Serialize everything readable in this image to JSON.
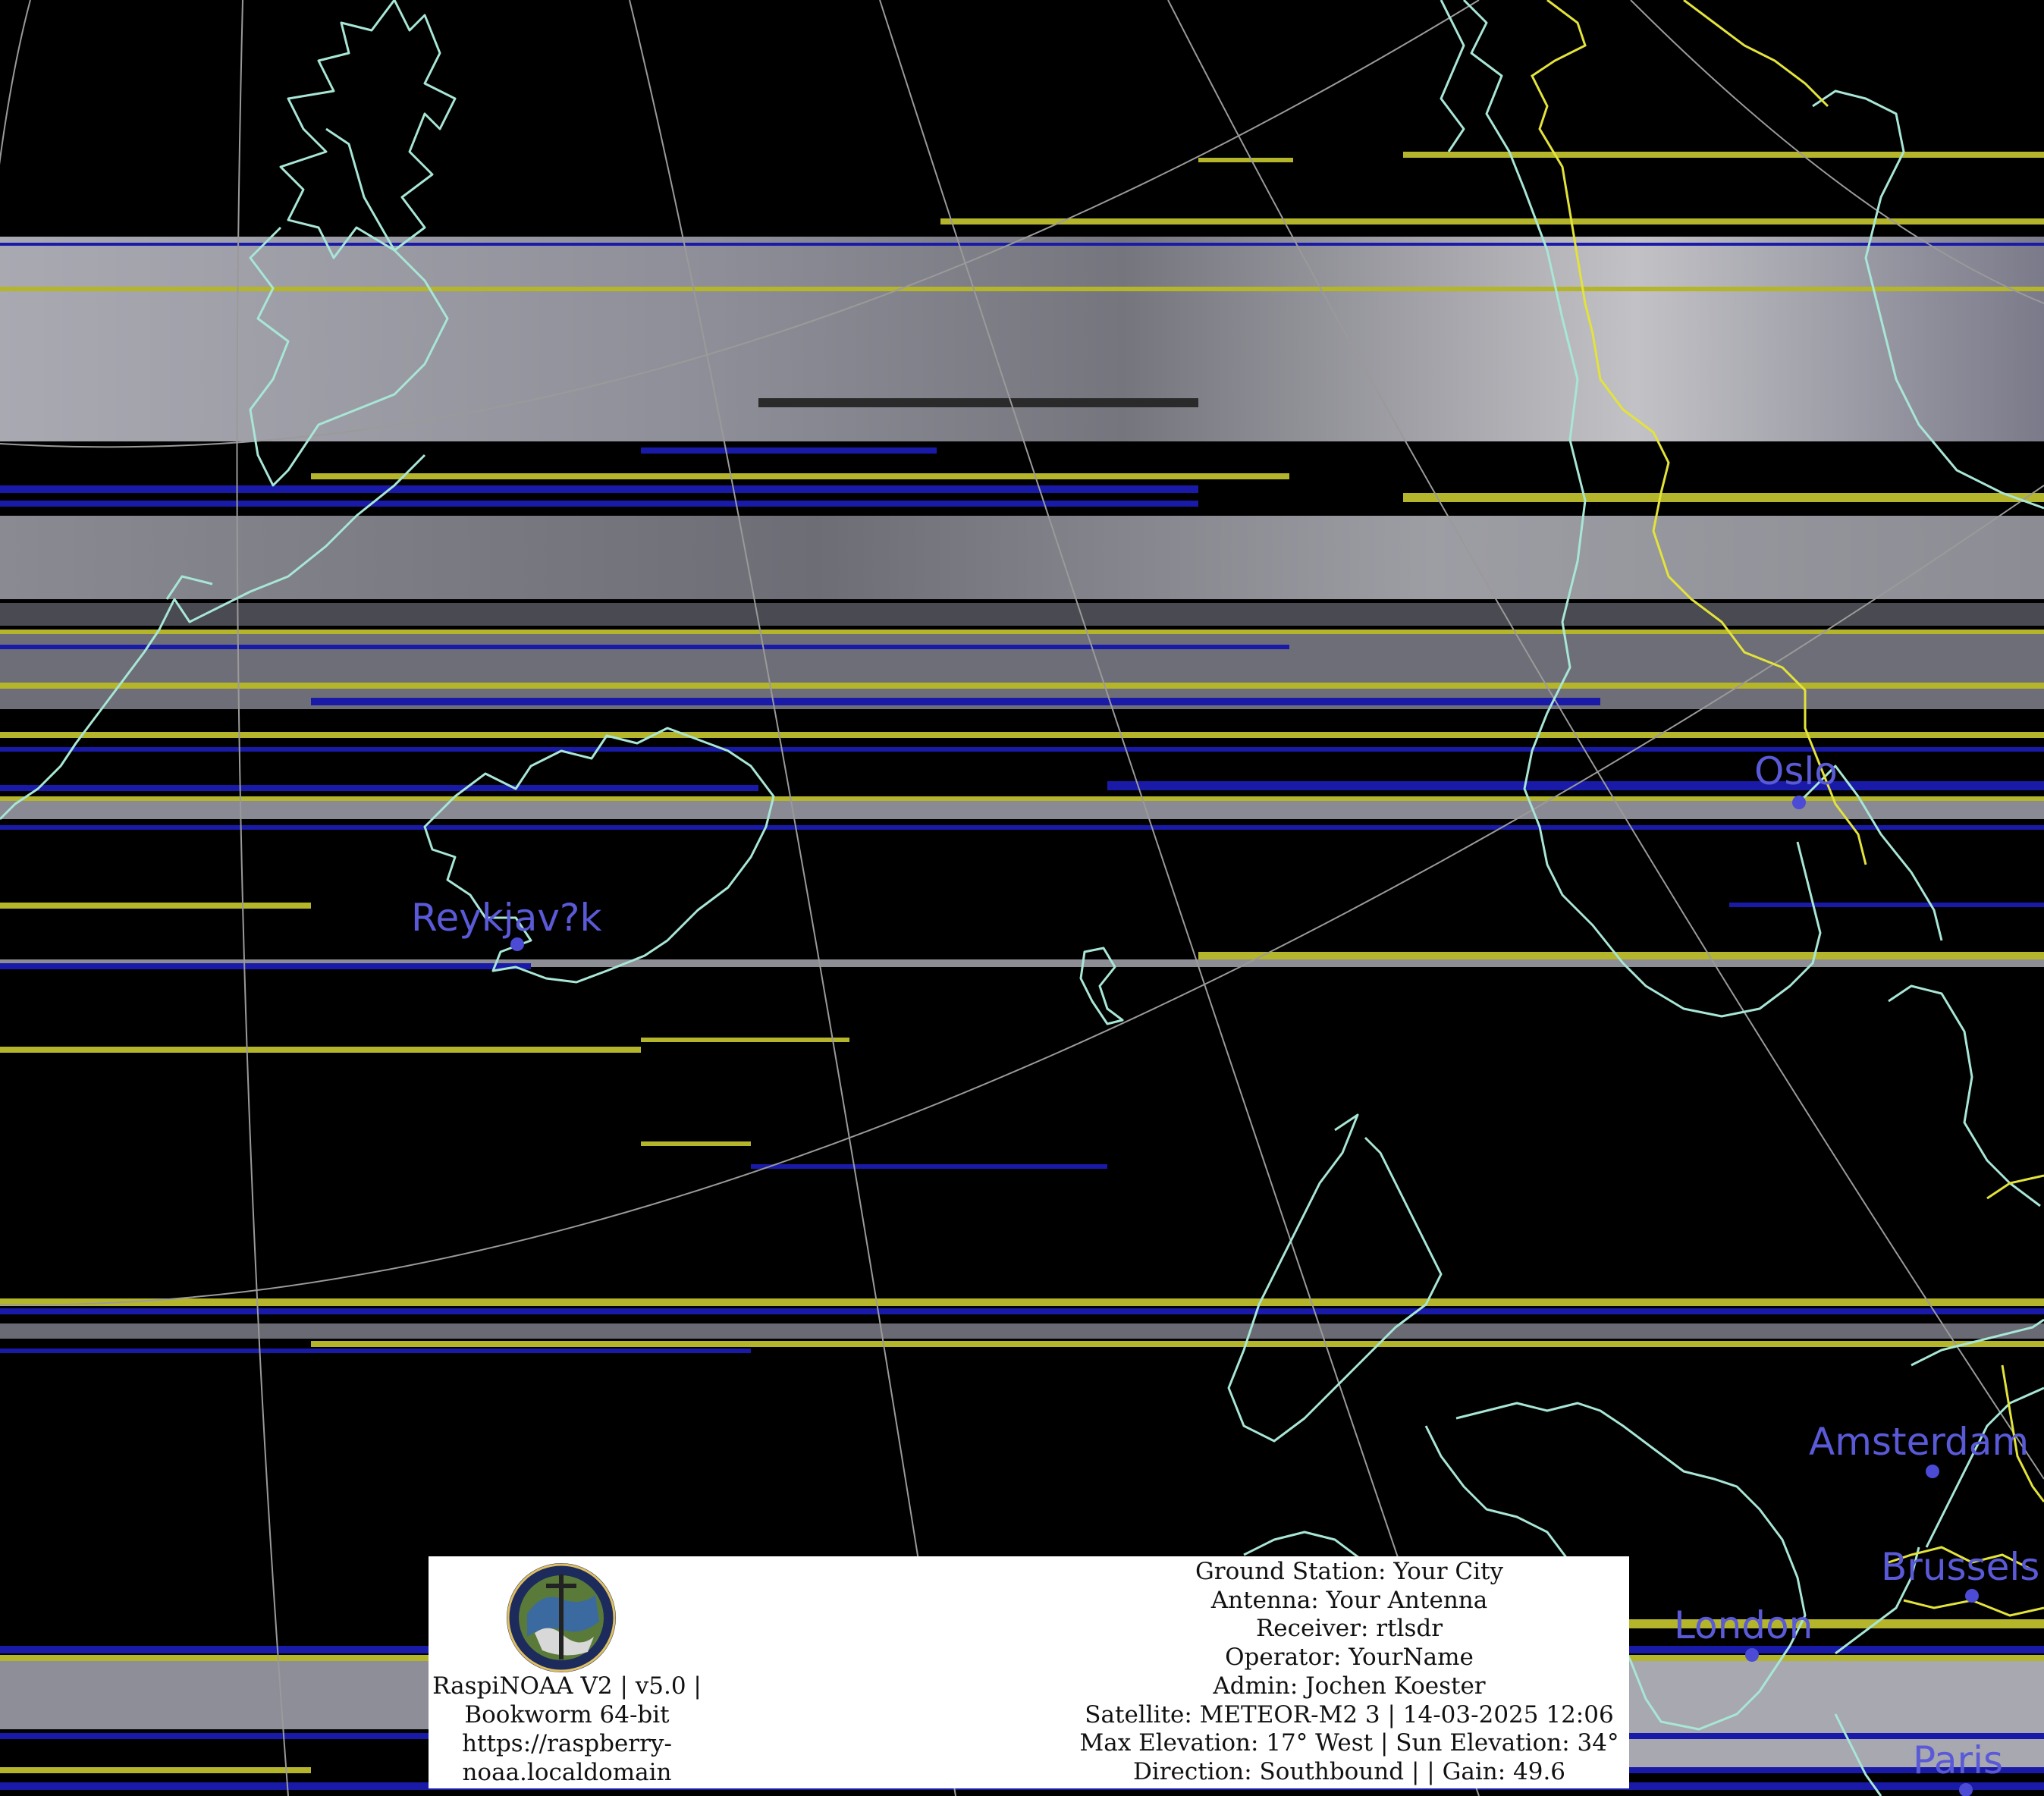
{
  "map": {
    "cities": [
      {
        "name": "Reykjav?k"
      },
      {
        "name": "Oslo"
      },
      {
        "name": "Amsterdam"
      },
      {
        "name": "Brussels"
      },
      {
        "name": "London"
      },
      {
        "name": "Paris"
      }
    ],
    "colors": {
      "background": "#000000",
      "coastline": "#a8e6d6",
      "border": "#e3e33b",
      "graticule": "#9a9a9a",
      "city": "#5a5ad8",
      "cloud": "#b4b4bc",
      "noise_yellow": "#b5b52c",
      "noise_blue": "#1a1aa8"
    }
  },
  "info_panel": {
    "logo_icon": "raspinoaa-logo-icon",
    "software_lines": [
      "RaspiNOAA V2 | v5.0 |",
      "Bookworm 64-bit",
      "https://raspberry-",
      "noaa.localdomain"
    ],
    "pass_lines": [
      "Ground Station: Your City",
      "Antenna: Your Antenna",
      "Receiver: rtlsdr",
      "Operator: YourName",
      "Admin: Jochen Koester",
      "Satellite: METEOR-M2 3 | 14-03-2025 12:06",
      "Max Elevation: 17° West | Sun Elevation: 34°",
      "Direction: Southbound | | Gain: 49.6"
    ]
  }
}
